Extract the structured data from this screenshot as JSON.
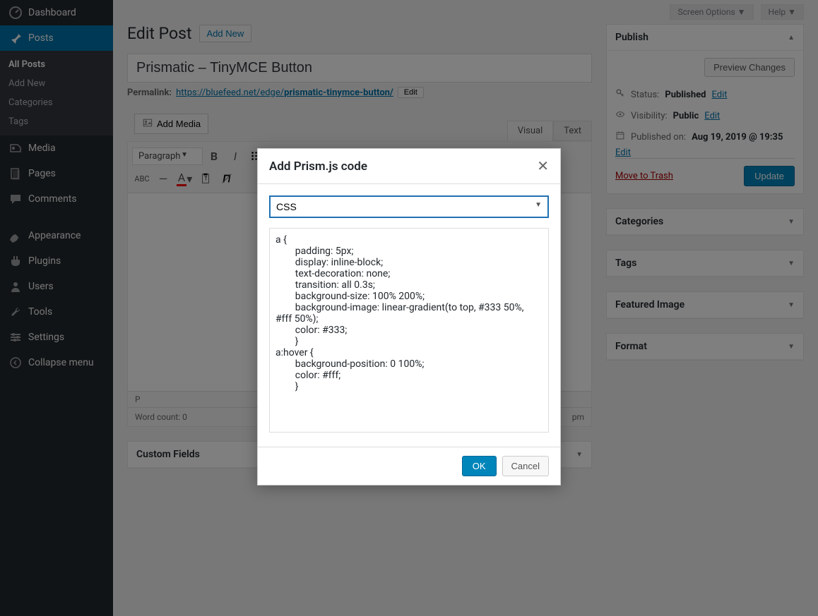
{
  "sidebar": {
    "items": [
      {
        "icon": "dashboard",
        "label": "Dashboard"
      },
      {
        "icon": "pin",
        "label": "Posts",
        "active": true
      },
      {
        "icon": "media",
        "label": "Media"
      },
      {
        "icon": "pages",
        "label": "Pages"
      },
      {
        "icon": "comments",
        "label": "Comments"
      },
      {
        "icon": "appearance",
        "label": "Appearance"
      },
      {
        "icon": "plugins",
        "label": "Plugins"
      },
      {
        "icon": "users",
        "label": "Users"
      },
      {
        "icon": "tools",
        "label": "Tools"
      },
      {
        "icon": "settings",
        "label": "Settings"
      }
    ],
    "sub_posts": [
      "All Posts",
      "Add New",
      "Categories",
      "Tags"
    ],
    "collapse": "Collapse menu"
  },
  "topbar": {
    "screen_options": "Screen Options",
    "help": "Help"
  },
  "heading": {
    "title": "Edit Post",
    "add_new": "Add New"
  },
  "post": {
    "title": "Prismatic – TinyMCE Button",
    "permalink_label": "Permalink:",
    "permalink_base": "https://bluefeed.net/edge/",
    "permalink_slug": "prismatic-tinymce-button/",
    "edit": "Edit"
  },
  "editor": {
    "add_media": "Add Media",
    "tabs": {
      "visual": "Visual",
      "text": "Text"
    },
    "format": "Paragraph",
    "status_path": "P",
    "word_count_label": "Word count: 0",
    "last_edit_suffix": "pm"
  },
  "custom_fields": {
    "title": "Custom Fields"
  },
  "publish": {
    "title": "Publish",
    "preview": "Preview Changes",
    "status_label": "Status:",
    "status_value": "Published",
    "visibility_label": "Visibility:",
    "visibility_value": "Public",
    "published_label": "Published on:",
    "published_value": "Aug 19, 2019 @ 19:35",
    "edit": "Edit",
    "trash": "Move to Trash",
    "update": "Update"
  },
  "sideboxes": [
    "Categories",
    "Tags",
    "Featured Image",
    "Format"
  ],
  "modal": {
    "title": "Add Prism.js code",
    "language": "CSS",
    "code": "a {\n        padding: 5px;\n        display: inline-block;\n        text-decoration: none;\n        transition: all 0.3s;\n        background-size: 100% 200%;\n        background-image: linear-gradient(to top, #333 50%, #fff 50%);\n        color: #333;\n        }\na:hover {\n        background-position: 0 100%;\n        color: #fff;\n        }",
    "ok": "OK",
    "cancel": "Cancel"
  }
}
